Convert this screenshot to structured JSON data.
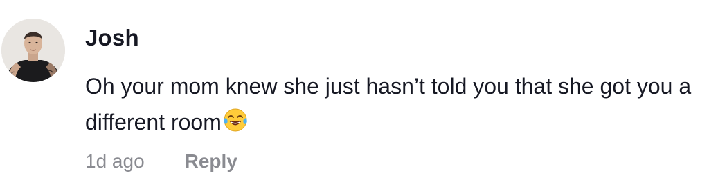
{
  "comment": {
    "username": "Josh",
    "text": "Oh your mom knew she just hasn’t told you that she got you a different room",
    "emoji_icon": "face-with-tears-of-joy-icon",
    "timestamp": "1d ago",
    "reply_label": "Reply",
    "avatar_icon": "user-avatar"
  },
  "colors": {
    "text_primary": "#161823",
    "text_secondary": "#8a8b91",
    "background": "#ffffff"
  }
}
